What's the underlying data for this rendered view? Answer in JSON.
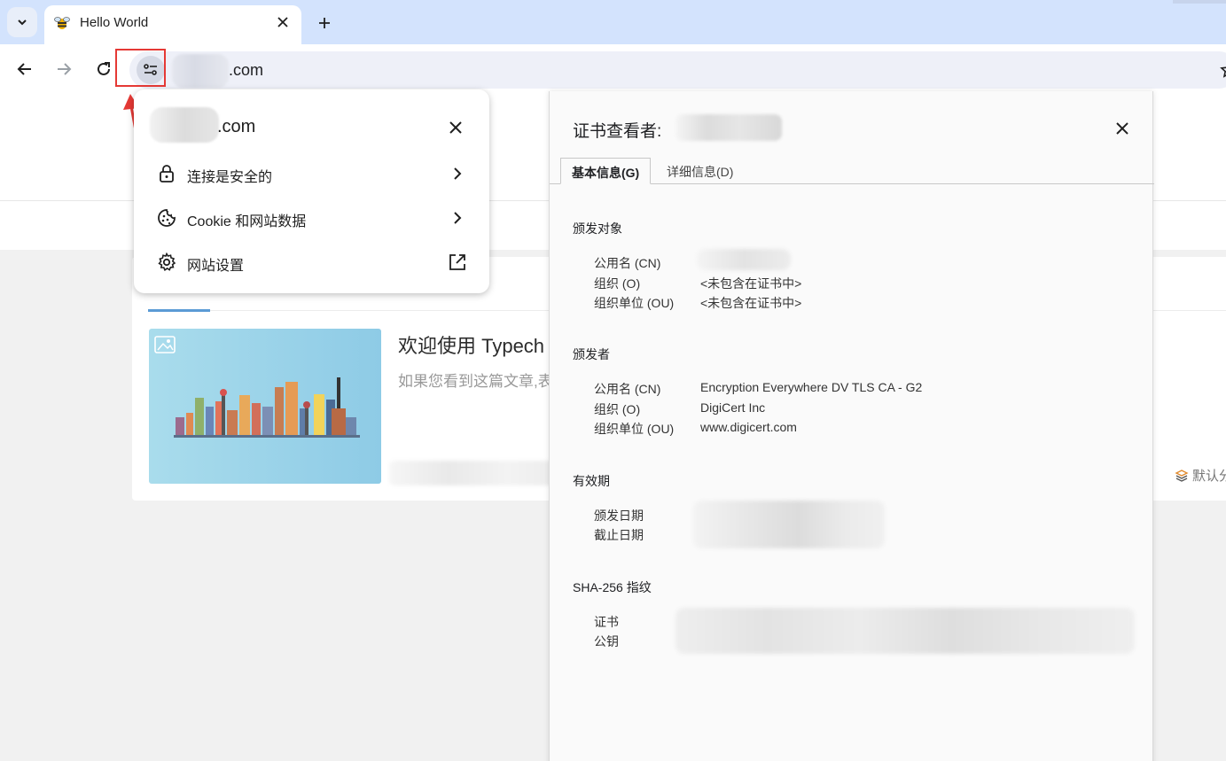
{
  "browser": {
    "tab": {
      "title": "Hello World"
    },
    "url_suffix": ".com"
  },
  "page": {
    "post_title": "欢迎使用 Typech",
    "post_excerpt": "如果您看到这篇文章,表",
    "category": "默认分"
  },
  "site_info_popup": {
    "domain_suffix": ".com",
    "items": [
      {
        "label": "连接是安全的",
        "icon": "lock-icon",
        "trail": "chevron-right-icon"
      },
      {
        "label": "Cookie 和网站数据",
        "icon": "cookie-icon",
        "trail": "chevron-right-icon"
      },
      {
        "label": "网站设置",
        "icon": "gear-icon",
        "trail": "open-external-icon"
      }
    ]
  },
  "cert_viewer": {
    "title": "证书查看者:",
    "tabs": [
      "基本信息(G)",
      "详细信息(D)"
    ],
    "issued_to": {
      "heading": "颁发对象",
      "cn_label": "公用名 (CN)",
      "o_label": "组织 (O)",
      "o_value": "<未包含在证书中>",
      "ou_label": "组织单位 (OU)",
      "ou_value": "<未包含在证书中>"
    },
    "issued_by": {
      "heading": "颁发者",
      "cn_label": "公用名 (CN)",
      "cn_value": "Encryption Everywhere DV TLS CA - G2",
      "o_label": "组织 (O)",
      "o_value": "DigiCert Inc",
      "ou_label": "组织单位 (OU)",
      "ou_value": "www.digicert.com"
    },
    "validity": {
      "heading": "有效期",
      "issued_label": "颁发日期",
      "expires_label": "截止日期"
    },
    "fingerprints": {
      "heading": "SHA-256 指纹",
      "cert_label": "证书",
      "key_label": "公钥"
    }
  },
  "colors": {
    "accent_blue": "#d3e3fd",
    "highlight_red": "#e53935"
  }
}
